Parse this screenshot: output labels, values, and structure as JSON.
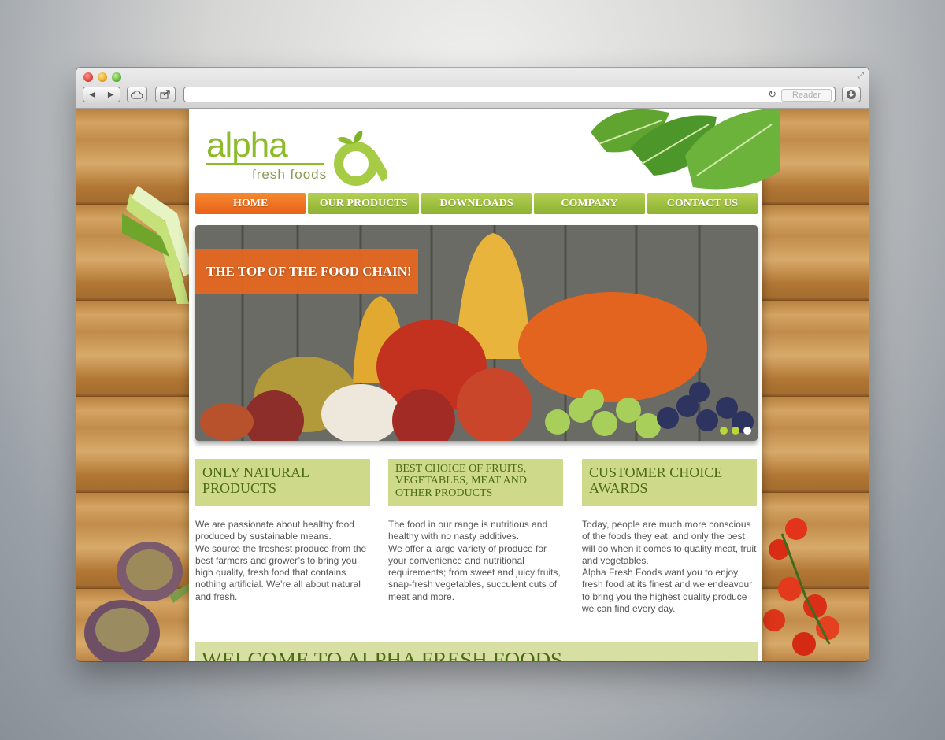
{
  "browser": {
    "nav_back": "◀",
    "nav_forward": "▶",
    "url": "",
    "reader_label": "Reader"
  },
  "site": {
    "logo_word": "alpha",
    "logo_sub": "fresh foods",
    "nav": [
      {
        "label": "HOME",
        "active": true
      },
      {
        "label": "OUR PRODUCTS"
      },
      {
        "label": "DOWNLOADS"
      },
      {
        "label": "COMPANY"
      },
      {
        "label": "CONTACT US"
      }
    ],
    "hero": {
      "banner": "THE TOP OF THE FOOD CHAIN!",
      "slide_count": 3,
      "active_slide": 3
    },
    "features": [
      {
        "title": "ONLY NATURAL\nPRODUCTS",
        "text": "We are passionate about healthy food produced by sustainable means.\nWe source the freshest produce from the best farmers and grower’s to bring you high quality, fresh food that contains nothing artificial. We’re all about natural and fresh."
      },
      {
        "title": "BEST CHOICE OF FRUITS,\nVEGETABLES, MEAT AND\nOTHER PRODUCTS",
        "text": "The food in our range is nutritious and healthy with no nasty additives.\nWe offer a large variety of produce for your convenience and nutritional requirements; from sweet and juicy fruits, snap-fresh vegetables, succulent cuts of meat and more."
      },
      {
        "title": "CUSTOMER CHOICE\nAWARDS",
        "text": "Today, people are much more conscious of the foods they eat, and only the best will do when it comes to quality meat, fruit and vegetables.\nAlpha Fresh Foods want you to enjoy fresh food at its finest and we endeavour to bring you the highest quality produce we can find every day."
      }
    ],
    "welcome": "WELCOME TO ALPHA FRESH FOODS"
  },
  "colors": {
    "accent_green": "#8dbb2c",
    "accent_orange": "#e9601a",
    "heading_green": "#4b6b13"
  }
}
